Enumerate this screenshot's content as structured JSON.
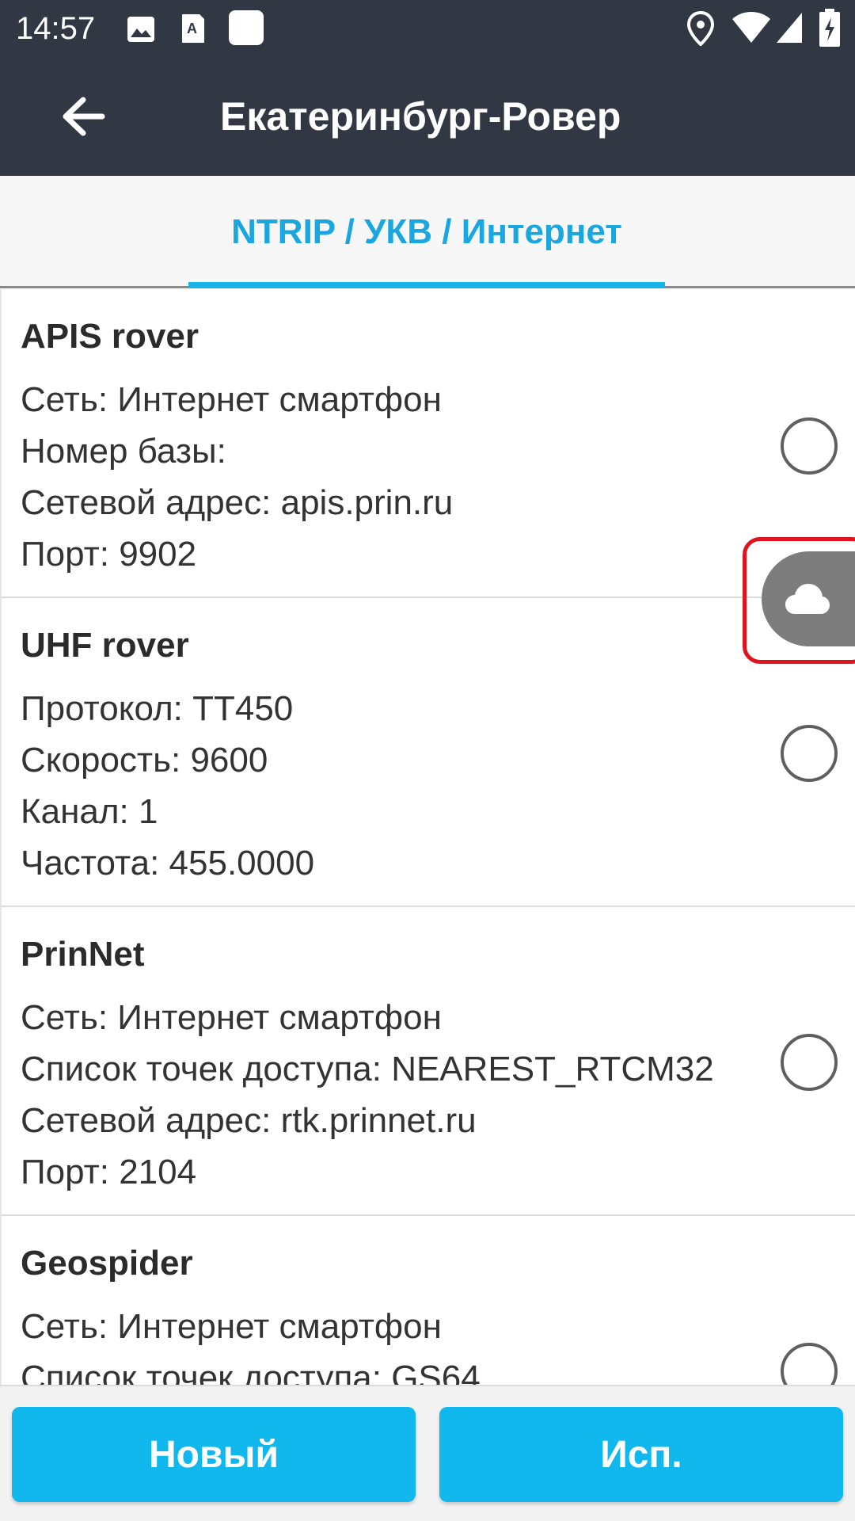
{
  "status_bar": {
    "time": "14:57"
  },
  "app_bar": {
    "title": "Екатеринбург-Ровер"
  },
  "tabs": [
    {
      "label": "NTRIP / УКВ / Интернет",
      "selected": true
    }
  ],
  "profiles": [
    {
      "name": "APIS rover",
      "lines": [
        "Сеть:  Интернет смартфон",
        "Номер базы:",
        "Сетевой адрес:  apis.prin.ru",
        "Порт:  9902"
      ],
      "selected": false
    },
    {
      "name": "UHF rover",
      "lines": [
        "Протокол:  TT450",
        "Скорость:  9600",
        "Канал:  1",
        "Частота:  455.0000"
      ],
      "selected": false
    },
    {
      "name": "PrinNet",
      "lines": [
        "Сеть:  Интернет смартфон",
        "Список точек доступа:  NEAREST_RTCM32",
        "Сетевой адрес:  rtk.prinnet.ru",
        "Порт:  2104"
      ],
      "selected": false
    },
    {
      "name": "Geospider",
      "lines": [
        "Сеть:  Интернет смартфон",
        "Список точек доступа:  GS64"
      ],
      "selected": false
    }
  ],
  "buttons": {
    "new_label": "Новый",
    "use_label": "Исп."
  },
  "icons": {
    "back": "arrow-left-icon",
    "floating": "cloud-icon"
  },
  "colors": {
    "header": "#323843",
    "accent": "#11b8ee",
    "highlight": "#e0141e"
  }
}
